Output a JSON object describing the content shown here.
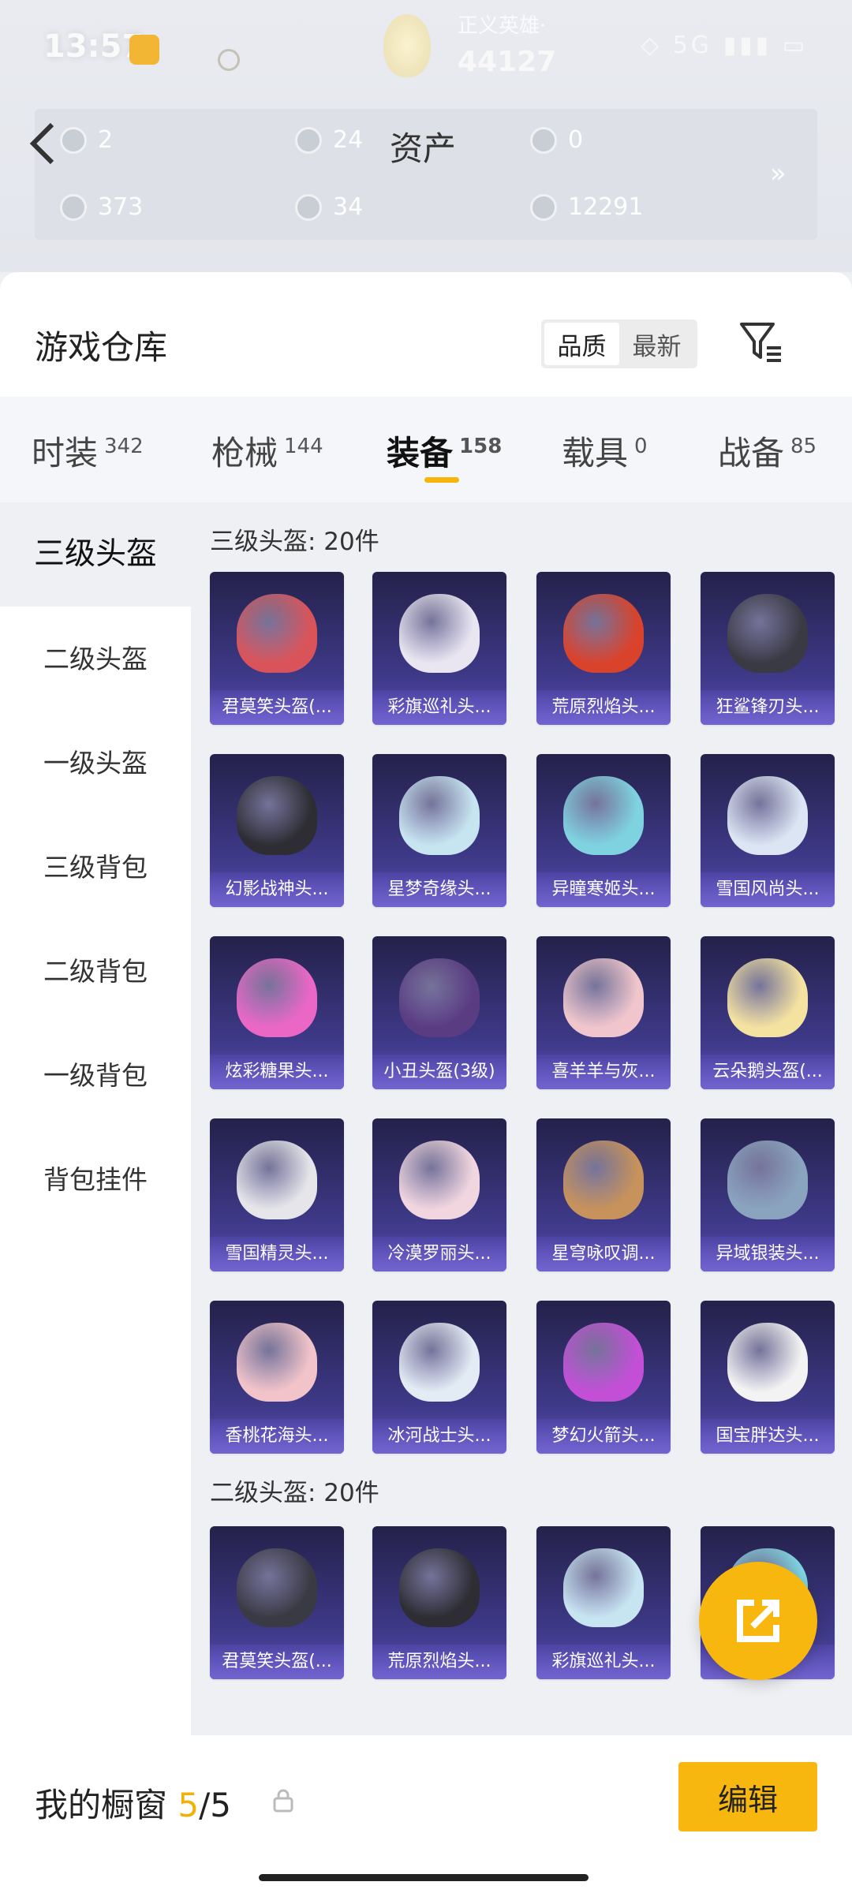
{
  "status": {
    "time": "13:57",
    "icons": "◇ 5G ▮▮▮ ▭"
  },
  "profile": {
    "user": "正义英雄·",
    "score": "44127"
  },
  "assets": {
    "title": "资产",
    "items": [
      {
        "value": "2"
      },
      {
        "value": "24"
      },
      {
        "value": "0"
      },
      {
        "value": "373"
      },
      {
        "value": "34"
      },
      {
        "value": "12291"
      }
    ],
    "more": "»"
  },
  "warehouse": {
    "title": "游戏仓库"
  },
  "sort": {
    "quality": "品质",
    "latest": "最新"
  },
  "tabs": [
    {
      "label": "时装",
      "count": "342"
    },
    {
      "label": "枪械",
      "count": "144"
    },
    {
      "label": "装备",
      "count": "158"
    },
    {
      "label": "载具",
      "count": "0"
    },
    {
      "label": "战备",
      "count": "85"
    }
  ],
  "categories": [
    "三级头盔",
    "二级头盔",
    "一级头盔",
    "三级背包",
    "二级背包",
    "一级背包",
    "背包挂件"
  ],
  "sections": [
    {
      "title": "三级头盔: 20件",
      "items": [
        "君莫笑头盔(...",
        "彩旗巡礼头...",
        "荒原烈焰头...",
        "狂鲨锋刃头...",
        "幻影战神头...",
        "星梦奇缘头...",
        "异瞳寒姬头...",
        "雪国风尚头...",
        "炫彩糖果头...",
        "小丑头盔(3级)",
        "喜羊羊与灰...",
        "云朵鹅头盔(...",
        "雪国精灵头...",
        "冷漠罗丽头...",
        "星穹咏叹调...",
        "异域银装头...",
        "香桃花海头...",
        "冰河战士头...",
        "梦幻火箭头...",
        "国宝胖达头..."
      ]
    },
    {
      "title": "二级头盔: 20件",
      "items": [
        "君莫笑头盔(...",
        "荒原烈焰头...",
        "彩旗巡礼头...",
        "..."
      ]
    }
  ],
  "showcase": {
    "label": "我的橱窗",
    "current": "5",
    "total": "/5",
    "edit": "编辑"
  },
  "colors": {
    "accent": "#f7b70e",
    "card_bg": "#3f3a8a"
  },
  "icons": {
    "back": "chevron-left-icon",
    "filter": "filter-icon",
    "fab": "share-icon",
    "lock": "lock-icon"
  }
}
